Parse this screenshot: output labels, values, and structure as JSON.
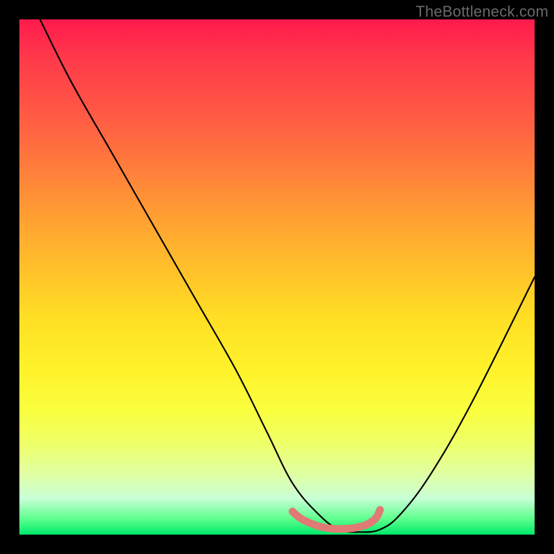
{
  "attribution": "TheBottleneck.com",
  "chart_data": {
    "type": "line",
    "title": "",
    "xlabel": "",
    "ylabel": "",
    "xlim": [
      0,
      100
    ],
    "ylim": [
      0,
      100
    ],
    "series": [
      {
        "name": "bottleneck-curve",
        "x_pct": [
          4,
          10,
          18,
          26,
          34,
          42,
          48,
          53,
          58,
          62,
          66,
          70,
          74,
          80,
          88,
          100
        ],
        "y_pct": [
          100,
          88,
          74,
          60,
          46,
          32,
          20,
          10,
          4,
          1,
          0.5,
          1,
          4,
          12,
          26,
          50
        ]
      }
    ],
    "plateau_marker": {
      "name": "plateau-red-band",
      "x_pct": [
        53,
        54.5,
        56.5,
        59,
        62,
        65,
        67.5,
        69.2,
        70
      ],
      "y_pct": [
        4.5,
        3.2,
        2.2,
        1.4,
        1.1,
        1.3,
        2.0,
        3.2,
        4.8
      ],
      "color": "#e07a74"
    },
    "gradient_colors": {
      "top": "#ff1a4d",
      "mid": "#ffdf24",
      "bottom": "#00e86a"
    }
  }
}
